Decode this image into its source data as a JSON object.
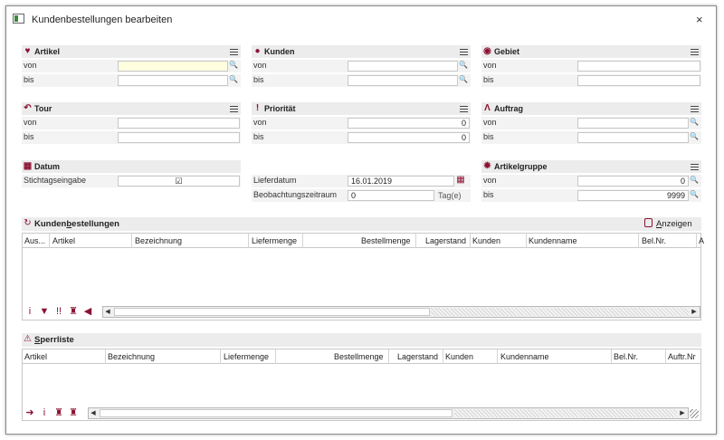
{
  "window": {
    "title": "Kundenbestellungen bearbeiten",
    "close_label": "×"
  },
  "labels": {
    "von": "von",
    "bis": "bis"
  },
  "artikel": {
    "title": "Artikel",
    "icon": "heart-icon",
    "von": "",
    "bis": ""
  },
  "kunden": {
    "title": "Kunden",
    "icon": "person-icon",
    "von": "",
    "bis": ""
  },
  "gebiet": {
    "title": "Gebiet",
    "icon": "globe-icon",
    "von": "",
    "bis": ""
  },
  "tour": {
    "title": "Tour",
    "icon": "return-arrow-icon",
    "von": "",
    "bis": ""
  },
  "prioritaet": {
    "title": "Priorität",
    "icon": "exclamation-icon",
    "von": "0",
    "bis": "0"
  },
  "auftrag": {
    "title": "Auftrag",
    "icon": "order-icon",
    "von": "",
    "bis": ""
  },
  "datum": {
    "title": "Datum",
    "icon": "calendar-icon",
    "stichtag_label": "Stichtagseingabe",
    "stichtag_checked": true
  },
  "liefer": {
    "lieferdatum_label": "Lieferdatum",
    "lieferdatum_value": "16.01.2019",
    "beobachtung_label": "Beobachtungszeitraum",
    "beobachtung_value": "0",
    "beobachtung_unit": "Tag(e)"
  },
  "artikelgruppe": {
    "title": "Artikelgruppe",
    "icon": "gear-icon",
    "von": "0",
    "bis": "9999"
  },
  "kundenbestellungen": {
    "title_pre": "Kunden",
    "title_u": "b",
    "title_post": "estellungen",
    "anzeigen_pre": "",
    "anzeigen_u": "A",
    "anzeigen_post": "nzeigen",
    "columns": [
      "Aus...",
      "Artikel",
      "Bezeichnung",
      "Liefermenge",
      "Bestellmenge",
      "Lagerstand",
      "Kunden",
      "Kundenname",
      "Bel.Nr.",
      "A"
    ]
  },
  "sperrliste": {
    "title_u": "S",
    "title_post": "perrliste",
    "columns": [
      "Artikel",
      "Bezeichnung",
      "Liefermenge",
      "Bestellmenge",
      "Lagerstand",
      "Kunden",
      "Kundenname",
      "Bel.Nr.",
      "Auftr.Nr"
    ]
  }
}
